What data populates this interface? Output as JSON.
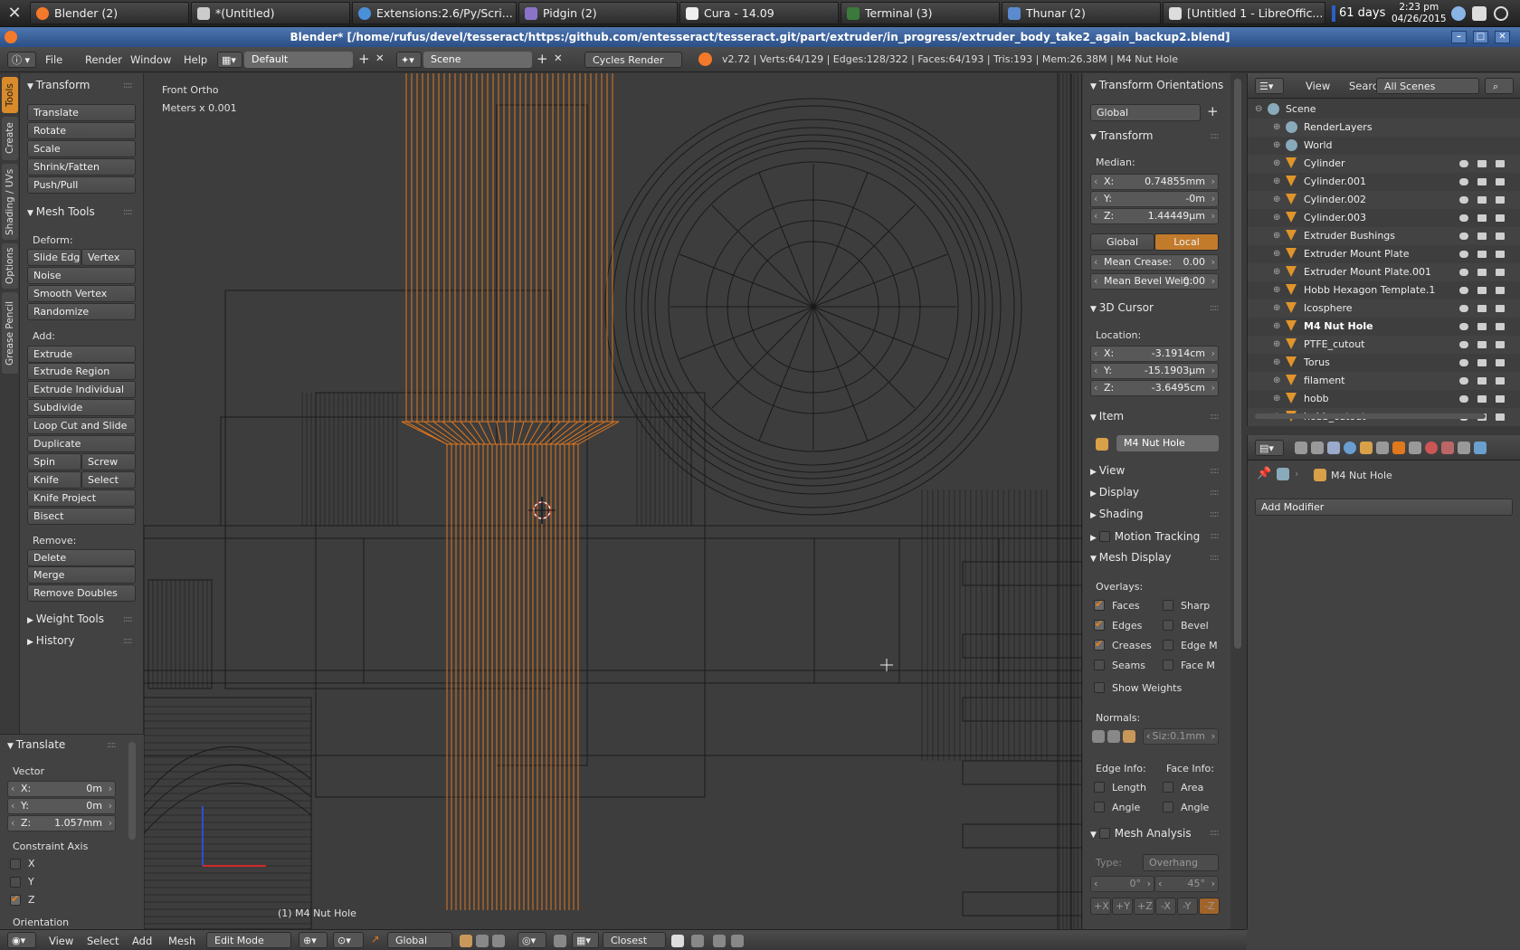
{
  "taskbar": {
    "tasks": [
      {
        "label": "Blender (2)",
        "color": "#f5792a"
      },
      {
        "label": "*(Untitled)",
        "color": "#dddddd"
      },
      {
        "label": "Extensions:2.6/Py/Scri...",
        "color": "#4a90d9"
      },
      {
        "label": "Pidgin (2)",
        "color": "#8b74c7"
      },
      {
        "label": "Cura - 14.09",
        "color": "#eeeeee"
      },
      {
        "label": "Terminal (3)",
        "color": "#3a7a3a"
      },
      {
        "label": "Thunar (2)",
        "color": "#5a8ad0"
      },
      {
        "label": "[Untitled 1 - LibreOffic...",
        "color": "#dddddd"
      }
    ],
    "days": "61 days",
    "time": "2:23 pm",
    "date": "04/26/2015"
  },
  "window_title": "Blender* [/home/rufus/devel/tesseract/https:/github.com/entesseract/tesseract.git/part/extruder/in_progress/extruder_body_take2_again_backup2.blend]",
  "header": {
    "menus": [
      "File",
      "Render",
      "Window",
      "Help"
    ],
    "screen_layout": "Default",
    "scene": "Scene",
    "render_engine": "Cycles Render",
    "stats": "v2.72 | Verts:64/129 | Edges:128/322 | Faces:64/193 | Tris:193 | Mem:26.38M | M4 Nut Hole"
  },
  "tool_tabs": [
    "Tools",
    "Create",
    "Shading / UVs",
    "Options",
    "Grease Pencil"
  ],
  "tool_shelf": {
    "transform": {
      "title": "Transform",
      "buttons": [
        "Translate",
        "Rotate",
        "Scale",
        "Shrink/Fatten",
        "Push/Pull"
      ]
    },
    "mesh_tools": {
      "title": "Mesh Tools",
      "deform_label": "Deform:",
      "slide_edge": "Slide Edg",
      "vertex": "Vertex",
      "deform_buttons": [
        "Noise",
        "Smooth Vertex",
        "Randomize"
      ],
      "add_label": "Add:",
      "extrude": "Extrude",
      "add_buttons": [
        "Extrude Region",
        "Extrude Individual",
        "Subdivide",
        "Loop Cut and Slide",
        "Duplicate"
      ],
      "spin": "Spin",
      "screw": "Screw",
      "knife": "Knife",
      "select": "Select",
      "knife_project": "Knife Project",
      "bisect": "Bisect",
      "remove_label": "Remove:",
      "delete": "Delete",
      "merge": "Merge",
      "remove_doubles": "Remove Doubles"
    },
    "weight_tools": "Weight Tools",
    "history": "History"
  },
  "last_operator": {
    "title": "Translate",
    "vector_label": "Vector",
    "x": {
      "label": "X:",
      "value": "0m"
    },
    "y": {
      "label": "Y:",
      "value": "0m"
    },
    "z": {
      "label": "Z:",
      "value": "1.057mm"
    },
    "constraint_label": "Constraint Axis",
    "axes": [
      {
        "label": "X",
        "checked": false
      },
      {
        "label": "Y",
        "checked": false
      },
      {
        "label": "Z",
        "checked": true
      }
    ],
    "orientation_label": "Orientation"
  },
  "viewport": {
    "view_name": "Front Ortho",
    "units": "Meters x 0.001",
    "object_label": "(1) M4 Nut Hole",
    "selection_color": "#e0781e"
  },
  "npanel": {
    "transform_orientations": {
      "title": "Transform Orientations",
      "value": "Global"
    },
    "transform": {
      "title": "Transform",
      "median_label": "Median:",
      "x": {
        "label": "X:",
        "value": "0.74855mm"
      },
      "y": {
        "label": "Y:",
        "value": "-0m"
      },
      "z": {
        "label": "Z:",
        "value": "1.44449µm"
      },
      "global": "Global",
      "local": "Local",
      "mean_crease": {
        "label": "Mean Crease:",
        "value": "0.00"
      },
      "mean_bevel": {
        "label": "Mean Bevel Weig:",
        "value": "0.00"
      }
    },
    "cursor": {
      "title": "3D Cursor",
      "location_label": "Location:",
      "x": {
        "label": "X:",
        "value": "-3.1914cm"
      },
      "y": {
        "label": "Y:",
        "value": "-15.1903µm"
      },
      "z": {
        "label": "Z:",
        "value": "-3.6495cm"
      }
    },
    "item": {
      "title": "Item",
      "name": "M4 Nut Hole"
    },
    "collapsed": [
      "View",
      "Display",
      "Shading",
      "Motion Tracking"
    ],
    "mesh_display": {
      "title": "Mesh Display",
      "overlays_label": "Overlays:",
      "overlays": [
        {
          "label": "Faces",
          "checked": true
        },
        {
          "label": "Sharp",
          "checked": false
        },
        {
          "label": "Edges",
          "checked": true
        },
        {
          "label": "Bevel",
          "checked": false
        },
        {
          "label": "Creases",
          "checked": true
        },
        {
          "label": "Edge M",
          "checked": false
        },
        {
          "label": "Seams",
          "checked": false
        },
        {
          "label": "Face M",
          "checked": false
        }
      ],
      "show_weights": "Show Weights",
      "normals_label": "Normals:",
      "normal_size": "Siz:0.1mm",
      "edge_info_label": "Edge Info:",
      "face_info_label": "Face Info:",
      "length": "Length",
      "area": "Area",
      "angle_e": "Angle",
      "angle_f": "Angle"
    },
    "mesh_analysis": {
      "title": "Mesh Analysis",
      "type_label": "Type:",
      "type_value": "Overhang",
      "min": "0°",
      "max": "45°",
      "axes": [
        "+X",
        "+Y",
        "+Z",
        "-X",
        "-Y",
        "-Z"
      ]
    }
  },
  "outliner": {
    "view": "View",
    "search": "Search",
    "filter": "All Scenes",
    "items": [
      {
        "name": "Scene",
        "level": 0
      },
      {
        "name": "RenderLayers",
        "level": 1
      },
      {
        "name": "World",
        "level": 1
      },
      {
        "name": "Cylinder",
        "level": 1
      },
      {
        "name": "Cylinder.001",
        "level": 1
      },
      {
        "name": "Cylinder.002",
        "level": 1
      },
      {
        "name": "Cylinder.003",
        "level": 1
      },
      {
        "name": "Extruder Bushings",
        "level": 1
      },
      {
        "name": "Extruder Mount Plate",
        "level": 1
      },
      {
        "name": "Extruder Mount Plate.001",
        "level": 1
      },
      {
        "name": "Hobb Hexagon Template.1",
        "level": 1
      },
      {
        "name": "Icosphere",
        "level": 1
      },
      {
        "name": "M4 Nut Hole",
        "level": 1
      },
      {
        "name": "PTFE_cutout",
        "level": 1
      },
      {
        "name": "Torus",
        "level": 1
      },
      {
        "name": "filament",
        "level": 1
      },
      {
        "name": "hobb",
        "level": 1
      },
      {
        "name": "hobb_cutout",
        "level": 1
      }
    ]
  },
  "properties": {
    "object_name": "M4 Nut Hole",
    "add_modifier": "Add Modifier"
  },
  "bottom_bar": {
    "menus": [
      "View",
      "Select",
      "Add",
      "Mesh"
    ],
    "mode": "Edit Mode",
    "orientation": "Global",
    "snap": "Closest"
  }
}
